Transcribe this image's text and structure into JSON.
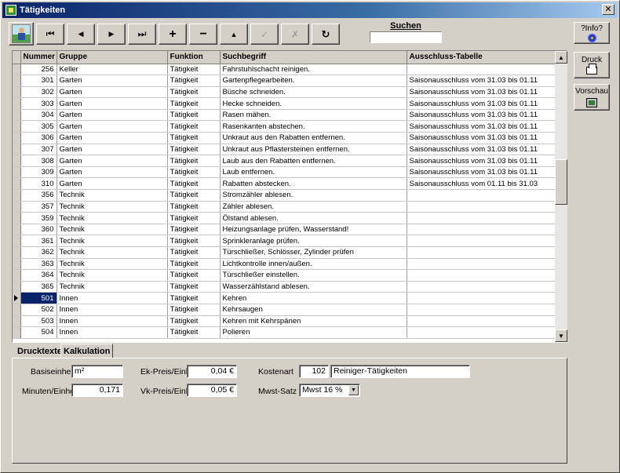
{
  "window": {
    "title": "Tätigkeiten",
    "close_glyph": "✕"
  },
  "toolbar": {
    "first_glyph": "⏮",
    "prev_glyph": "◀",
    "next_glyph": "▶",
    "last_glyph": "⏭",
    "add_glyph": "+",
    "remove_glyph": "−",
    "up_glyph": "▲",
    "confirm_glyph": "✓",
    "cancel_glyph": "✗",
    "refresh_glyph": "↻"
  },
  "search": {
    "label": "Suchen",
    "value": ""
  },
  "info_button": {
    "label": "?Info?"
  },
  "side_buttons": {
    "print_label": "Druck",
    "preview_label": "Vorschau"
  },
  "grid": {
    "columns": [
      "Nummer",
      "Gruppe",
      "Funktion",
      "Suchbegriff",
      "Ausschluss-Tabelle"
    ],
    "selected_row": 20,
    "rows": [
      [
        "256",
        "Keller",
        "Tätigkeit",
        "Fahrstuhlschacht reinigen.",
        ""
      ],
      [
        "301",
        "Garten",
        "Tätigkeit",
        "Gartenpflegearbeiten.",
        "Saisonausschluss vom 31.03 bis 01.11"
      ],
      [
        "302",
        "Garten",
        "Tätigkeit",
        "Büsche schneiden.",
        "Saisonausschluss vom 31.03 bis 01.11"
      ],
      [
        "303",
        "Garten",
        "Tätigkeit",
        "Hecke schneiden.",
        "Saisonausschluss vom 31.03 bis 01.11"
      ],
      [
        "304",
        "Garten",
        "Tätigkeit",
        "Rasen mähen.",
        "Saisonausschluss vom 31.03 bis 01.11"
      ],
      [
        "305",
        "Garten",
        "Tätigkeit",
        "Rasenkanten abstechen.",
        "Saisonausschluss vom 31.03 bis 01.11"
      ],
      [
        "306",
        "Garten",
        "Tätigkeit",
        "Unkraut aus den Rabatten entfernen.",
        "Saisonausschluss vom 31.03 bis 01.11"
      ],
      [
        "307",
        "Garten",
        "Tätigkeit",
        "Unkraut aus Pflastersteinen entfernen.",
        "Saisonausschluss vom 31.03 bis 01.11"
      ],
      [
        "308",
        "Garten",
        "Tätigkeit",
        "Laub aus den Rabatten entfernen.",
        "Saisonausschluss vom 31.03 bis 01.11"
      ],
      [
        "309",
        "Garten",
        "Tätigkeit",
        "Laub entfernen.",
        "Saisonausschluss vom 31.03 bis 01.11"
      ],
      [
        "310",
        "Garten",
        "Tätigkeit",
        "Rabatten abstecken.",
        "Saisonausschluss vom 01.11 bis 31.03"
      ],
      [
        "356",
        "Technik",
        "Tätigkeit",
        "Stromzähler ablesen.",
        ""
      ],
      [
        "357",
        "Technik",
        "Tätigkeit",
        "Zähler ablesen.",
        ""
      ],
      [
        "359",
        "Technik",
        "Tätigkeit",
        "Ölstand ablesen.",
        ""
      ],
      [
        "360",
        "Technik",
        "Tätigkeit",
        "Heizungsanlage prüfen, Wasserstand!",
        ""
      ],
      [
        "361",
        "Technik",
        "Tätigkeit",
        "Sprinkleranlage prüfen.",
        ""
      ],
      [
        "362",
        "Technik",
        "Tätigkeit",
        "Türschließer, Schlösser, Zylinder prüfen",
        ""
      ],
      [
        "363",
        "Technik",
        "Tätigkeit",
        "Lichtkontrolle innen/außen.",
        ""
      ],
      [
        "364",
        "Technik",
        "Tätigkeit",
        "Türschließer einstellen.",
        ""
      ],
      [
        "365",
        "Technik",
        "Tätigkeit",
        "Wasserzählstand ablesen.",
        ""
      ],
      [
        "501",
        "Innen",
        "Tätigkeit",
        "Kehren",
        ""
      ],
      [
        "502",
        "Innen",
        "Tätigkeit",
        "Kehrsaugen",
        ""
      ],
      [
        "503",
        "Innen",
        "Tätigkeit",
        "Kehren mit Kehrspänen",
        ""
      ],
      [
        "504",
        "Innen",
        "Tätigkeit",
        "Polieren",
        ""
      ]
    ]
  },
  "tabs": {
    "drucktexte": "Drucktexte",
    "kalkulation": "Kalkulation"
  },
  "form": {
    "basiseinheit_label": "Basiseinheit",
    "basiseinheit_value": "m²",
    "minuten_label": "Minuten/Einheit",
    "minuten_value": "0,171",
    "ek_label": "Ek-Preis/Einh.",
    "ek_value": "0,04 €",
    "vk_label": "Vk-Preis/Einh.",
    "vk_value": "0,05 €",
    "kostenart_label": "Kostenart",
    "kostenart_code": "102",
    "kostenart_name": "Reiniger-Tätigkeiten",
    "mwst_label": "Mwst-Satz",
    "mwst_value": "Mwst 16 %"
  },
  "colors": {
    "selection": "#0a246a",
    "face": "#d4d0c8",
    "title_start": "#0a246a"
  }
}
